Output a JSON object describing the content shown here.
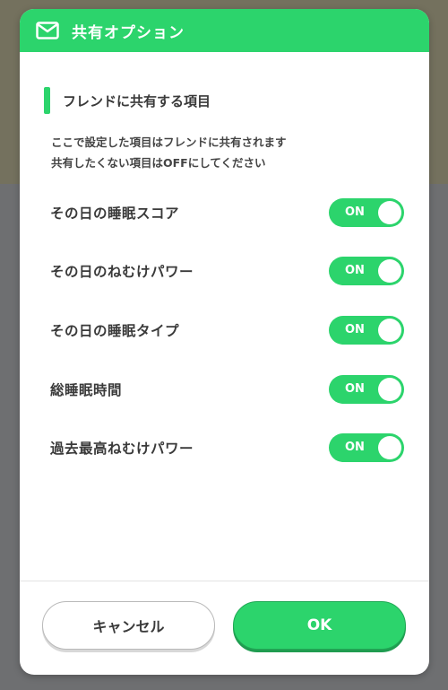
{
  "dialog": {
    "title": "共有オプション",
    "header_icon": "mail-icon"
  },
  "section": {
    "title": "フレンドに共有する項目",
    "description_lines": [
      "ここで設定した項目はフレンドに共有されます",
      "共有したくない項目はOFFにしてください"
    ]
  },
  "settings": [
    {
      "label": "その日の睡眠スコア",
      "toggle": "ON"
    },
    {
      "label": "その日のねむけパワー",
      "toggle": "ON"
    },
    {
      "label": "その日の睡眠タイプ",
      "toggle": "ON"
    },
    {
      "label": "総睡眠時間",
      "toggle": "ON"
    },
    {
      "label": "過去最高ねむけパワー",
      "toggle": "ON"
    }
  ],
  "buttons": {
    "cancel": "キャンセル",
    "ok": "OK"
  },
  "colors": {
    "accent": "#2cd46c"
  }
}
